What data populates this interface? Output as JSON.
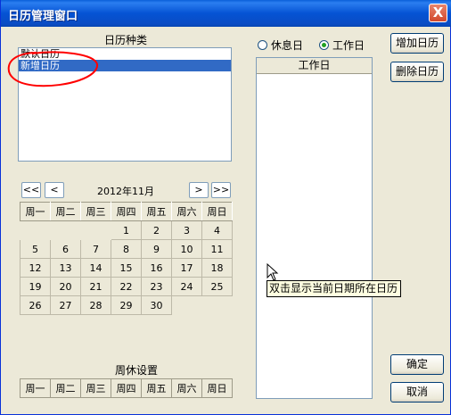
{
  "window": {
    "title": "日历管理窗口",
    "close_glyph": "X"
  },
  "calendar_types": {
    "label": "日历种类",
    "items": [
      {
        "label": "默认日历",
        "selected": false
      },
      {
        "label": "新增日历",
        "selected": true
      }
    ]
  },
  "nav": {
    "first": "<<",
    "prev": "<",
    "next": ">",
    "last": ">>",
    "month_label": "2012年11月"
  },
  "weekdays": [
    "周一",
    "周二",
    "周三",
    "周四",
    "周五",
    "周六",
    "周日"
  ],
  "month_weeks": [
    [
      "",
      "",
      "",
      "1",
      "2",
      "3",
      "4"
    ],
    [
      "5",
      "6",
      "7",
      "8",
      "9",
      "10",
      "11"
    ],
    [
      "12",
      "13",
      "14",
      "15",
      "16",
      "17",
      "18"
    ],
    [
      "19",
      "20",
      "21",
      "22",
      "23",
      "24",
      "25"
    ],
    [
      "26",
      "27",
      "28",
      "29",
      "30",
      "",
      ""
    ]
  ],
  "weekly_settings": {
    "label": "周休设置"
  },
  "day_type": {
    "rest_label": "休息日",
    "work_label": "工作日",
    "selected": "work"
  },
  "work_list": {
    "header": "工作日",
    "tooltip": "双击显示当前日期所在日历"
  },
  "buttons": {
    "add": "增加日历",
    "delete": "删除日历",
    "ok": "确定",
    "cancel": "取消"
  },
  "colors": {
    "annotation": "#ff0000",
    "selection": "#316ac5"
  }
}
